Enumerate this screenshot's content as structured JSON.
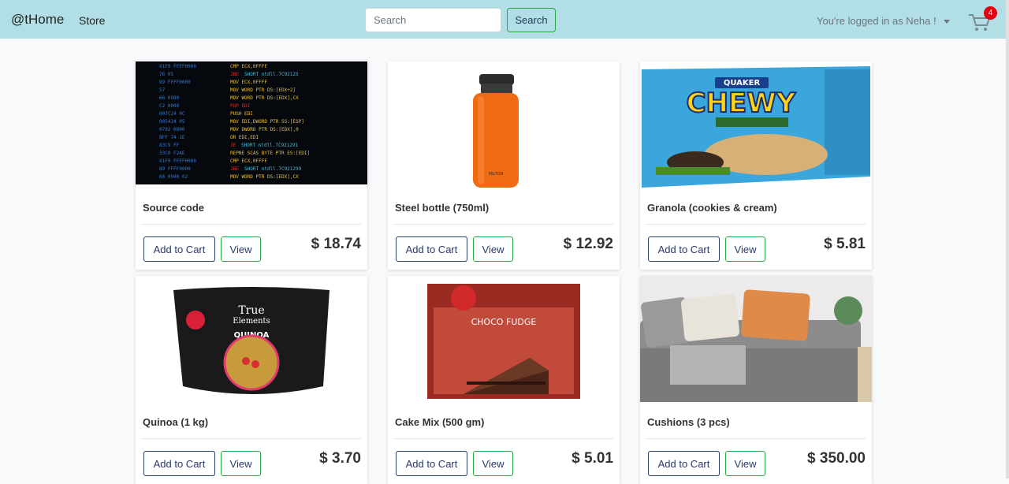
{
  "navbar": {
    "brand": "@tHome",
    "store_link": "Store",
    "search_placeholder": "Search",
    "search_button": "Search",
    "user_text": "You're logged in as Neha !",
    "cart_count": "4"
  },
  "colors": {
    "navbar_bg": "#b2dfe6",
    "badge": "#e3000f",
    "add_button_border": "#2a3a6a",
    "view_button_border": "#28a745"
  },
  "products": [
    {
      "name": "Source code",
      "price": "$ 18.74",
      "add_label": "Add to Cart",
      "view_label": "View",
      "image": "source-code-image"
    },
    {
      "name": "Steel bottle (750ml)",
      "price": "$ 12.92",
      "add_label": "Add to Cart",
      "view_label": "View",
      "image": "bottle-image"
    },
    {
      "name": "Granola (cookies & cream)",
      "price": "$ 5.81",
      "add_label": "Add to Cart",
      "view_label": "View",
      "image": "granola-box-image"
    },
    {
      "name": "Quinoa (1 kg)",
      "price": "$ 3.70",
      "add_label": "Add to Cart",
      "view_label": "View",
      "image": "quinoa-pouch-image"
    },
    {
      "name": "Cake Mix (500 gm)",
      "price": "$ 5.01",
      "add_label": "Add to Cart",
      "view_label": "View",
      "image": "cake-mix-image"
    },
    {
      "name": "Cushions (3 pcs)",
      "price": "$ 350.00",
      "add_label": "Add to Cart",
      "view_label": "View",
      "image": "cushions-image"
    }
  ]
}
